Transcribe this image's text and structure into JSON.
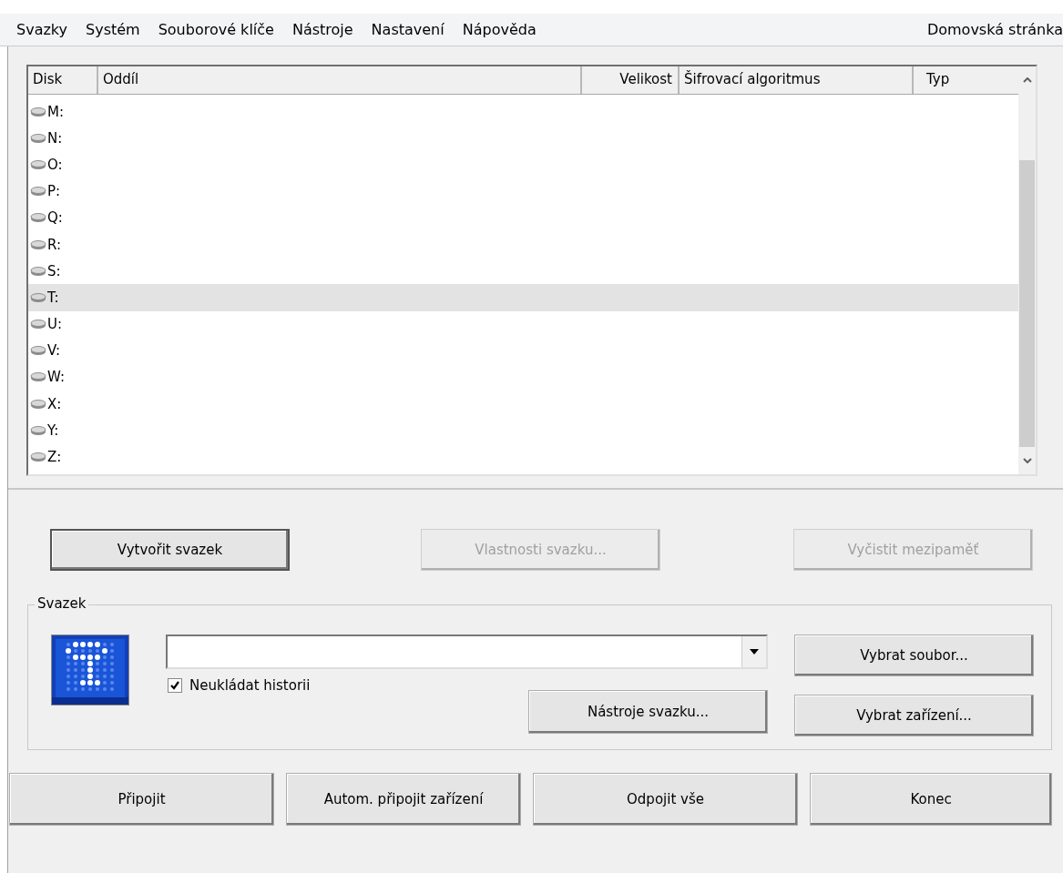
{
  "menu_bar": {
    "items": [
      "Svazky",
      "Systém",
      "Souborové klíče",
      "Nástroje",
      "Nastavení",
      "Nápověda"
    ],
    "right_item": "Domovská stránka"
  },
  "drive_list": {
    "columns": [
      "Disk",
      "Oddíl",
      "Velikost",
      "Šifrovací algoritmus",
      "Typ"
    ],
    "rows": [
      {
        "disk": "M:",
        "selected": false
      },
      {
        "disk": "N:",
        "selected": false
      },
      {
        "disk": "O:",
        "selected": false
      },
      {
        "disk": "P:",
        "selected": false
      },
      {
        "disk": "Q:",
        "selected": false
      },
      {
        "disk": "R:",
        "selected": false
      },
      {
        "disk": "S:",
        "selected": false
      },
      {
        "disk": "T:",
        "selected": true
      },
      {
        "disk": "U:",
        "selected": false
      },
      {
        "disk": "V:",
        "selected": false
      },
      {
        "disk": "W:",
        "selected": false
      },
      {
        "disk": "X:",
        "selected": false
      },
      {
        "disk": "Y:",
        "selected": false
      },
      {
        "disk": "Z:",
        "selected": false
      }
    ]
  },
  "volume_buttons": [
    {
      "label": "Vytvořit svazek",
      "disabled": false
    },
    {
      "label": "Vlastnosti svazku...",
      "disabled": true
    },
    {
      "label": "Vyčistit mezipaměť",
      "disabled": true
    }
  ],
  "volume_group": {
    "title": "Svazek",
    "checkbox": {
      "label": "Neukládat historii",
      "checked": true
    },
    "tools_button": "Nástroje svazku...",
    "select_file_button": "Vybrat soubor...",
    "select_device_button": "Vybrat zařízení..."
  },
  "bottom_buttons": [
    "Připojit",
    "Autom. připojit zařízení",
    "Odpojit vše",
    "Konec"
  ]
}
